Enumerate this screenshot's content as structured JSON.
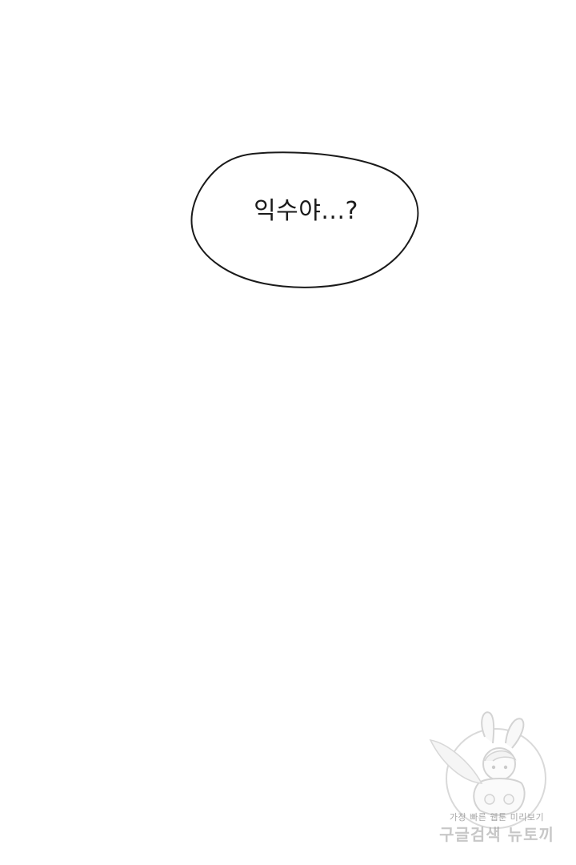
{
  "panel": {
    "background": "#ffffff",
    "bubble_text": "익수야...?",
    "bubble_outline_color": "#1a1a1a"
  },
  "watermark": {
    "line1": "가장 빠른 웹툰 미리보기",
    "line2": "구글검색 뉴토끼",
    "mascot": "bunny-girl-mascot-icon"
  }
}
